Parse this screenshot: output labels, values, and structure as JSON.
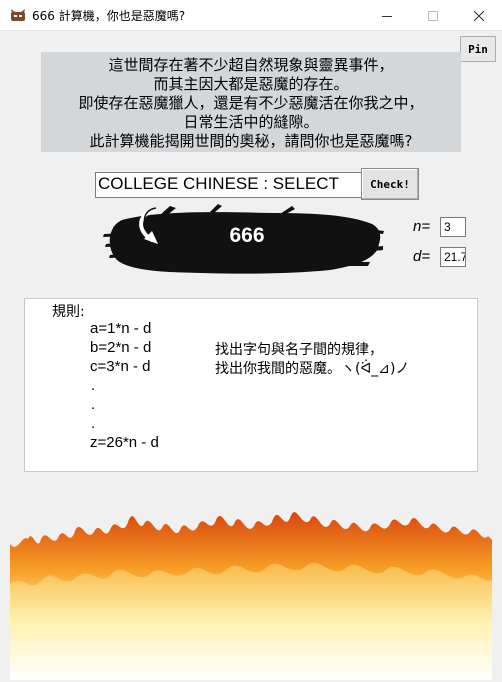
{
  "window": {
    "title": "666 計算機，你也是惡魔嗎?",
    "app_icon": "devil-app-icon",
    "controls": [
      "minimize-icon",
      "maximize-icon",
      "close-icon"
    ]
  },
  "pin_button": {
    "label": "Pin"
  },
  "intro": {
    "lines": [
      "這世間存在著不少超自然現象與靈異事件，",
      "而其主因大都是惡魔的存在。",
      "即使存在惡魔獵人，還是有不少惡魔活在你我之中，",
      "日常生活中的縫隙。",
      "此計算機能揭開世間的奧秘，請問你也是惡魔嗎?"
    ]
  },
  "query": {
    "value": "COLLEGE CHINESE : SELECT"
  },
  "check_button": {
    "label": "Check!"
  },
  "result": {
    "value": "666"
  },
  "params": {
    "n": {
      "label": "n=",
      "value": "3"
    },
    "d": {
      "label": "d=",
      "value": "21.7"
    }
  },
  "rules": {
    "heading": "規則:",
    "formulas": [
      "a=1*n - d",
      "b=2*n - d",
      "c=3*n - d",
      ".",
      ".",
      ".",
      "z=26*n - d"
    ],
    "hints": [
      "找出字句與名子間的規律，",
      "找出你我間的惡魔。ヽ(ᐛ_⊿)ノ"
    ]
  },
  "colors": {
    "intro_bg": "#d4d7da",
    "brush": "#111111",
    "fire_core": "#fff2b0",
    "fire_mid": "#f7a126",
    "fire_edge": "#d9470f"
  }
}
